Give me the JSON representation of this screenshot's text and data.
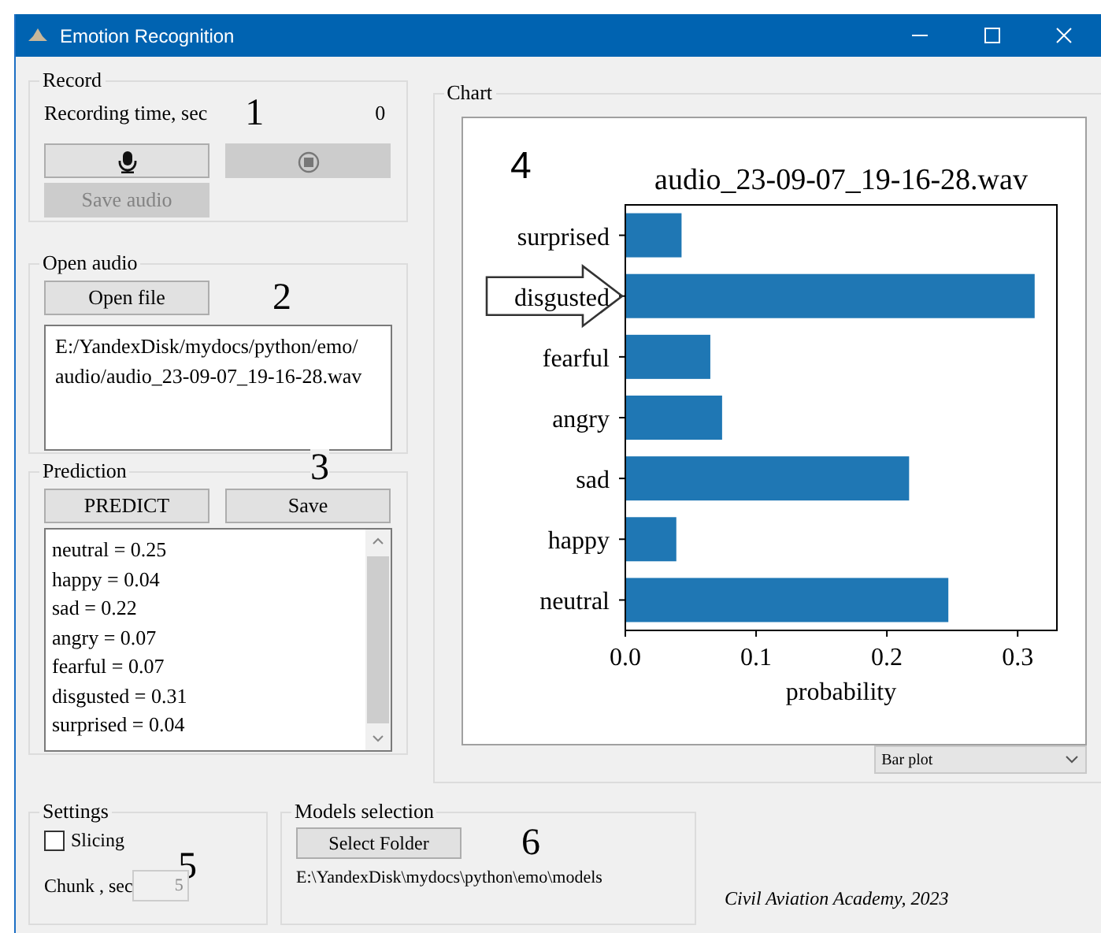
{
  "window": {
    "title": "Emotion Recognition"
  },
  "record": {
    "title": "Record",
    "label": "Recording time, sec",
    "callout": "1",
    "time": "0",
    "buttons": [
      {
        "kind": "mic",
        "disabled": false
      },
      {
        "kind": "stop",
        "disabled": true
      },
      {
        "kind": "text",
        "label": "Save audio",
        "disabled": true
      }
    ]
  },
  "open_audio": {
    "title": "Open audio",
    "callout": "2",
    "button": "Open file",
    "path": "E:/YandexDisk/mydocs/python/emo/audio/audio_23-09-07_19-16-28.wav"
  },
  "prediction": {
    "title": "Prediction",
    "callout": "3",
    "buttons": [
      "PREDICT",
      "Save"
    ],
    "lines": [
      "neutral = 0.25",
      "happy = 0.04",
      "sad = 0.22",
      "angry = 0.07",
      "fearful = 0.07",
      "disgusted = 0.31",
      "surprised = 0.04"
    ]
  },
  "chart": {
    "title": "Chart",
    "callout": "4",
    "plot_type": "Bar plot",
    "chart_data": {
      "type": "bar",
      "orientation": "horizontal",
      "title": "audio_23-09-07_19-16-28.wav",
      "xlabel": "probability",
      "categories": [
        "surprised",
        "disgusted",
        "fearful",
        "angry",
        "sad",
        "happy",
        "neutral"
      ],
      "series": [
        {
          "color": "#1f77b4",
          "values": [
            0.043,
            0.313,
            0.065,
            0.074,
            0.217,
            0.039,
            0.247
          ]
        }
      ],
      "xlim": [
        0,
        0.33
      ],
      "xticks": [
        {
          "value": 0,
          "label": "0.0"
        },
        {
          "value": 0.1,
          "label": "0.1"
        },
        {
          "value": 0.2,
          "label": "0.2"
        },
        {
          "value": 0.3,
          "label": "0.3"
        }
      ]
    },
    "highlighted": [
      false,
      true,
      false,
      false,
      false,
      false,
      false
    ]
  },
  "settings": {
    "title": "Settings",
    "callout": "5",
    "slicing": {
      "label": "Slicing",
      "checked": false
    },
    "chunk": {
      "label": "Chunk , sec",
      "value": "5",
      "disabled": true
    }
  },
  "models": {
    "title": "Models selection",
    "callout": "6",
    "button": "Select Folder",
    "path": "E:\\YandexDisk\\mydocs\\python\\emo\\models"
  },
  "footer": "Civil Aviation Academy, 2023"
}
